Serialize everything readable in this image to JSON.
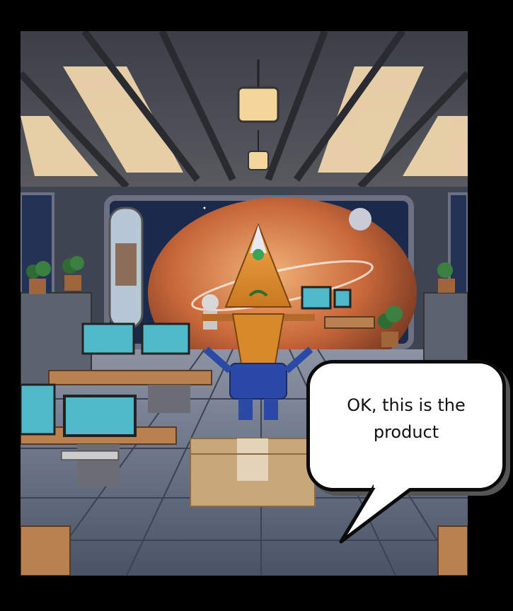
{
  "comic": {
    "speech_bubble": {
      "text": "OK, this is the product"
    }
  },
  "colors": {
    "frame": "#000000",
    "bubble_fill": "#ffffff",
    "bubble_outline": "#0b0b0b",
    "space_sky": "#1b2a4a",
    "planet": "#c8683a",
    "character_cone": "#e0902a",
    "character_suit": "#2b4aa8",
    "box": "#c8a878"
  },
  "icons": [
    "ceiling-lamp-icon",
    "potted-plant-icon",
    "computer-monitor-icon",
    "robot-icon",
    "cardboard-box-icon"
  ]
}
